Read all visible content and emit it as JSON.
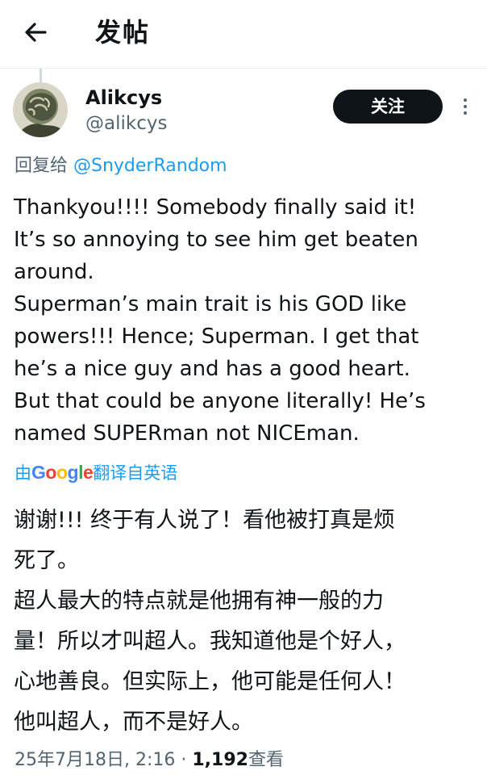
{
  "header": {
    "title": "发帖",
    "back_icon": "arrow-left-icon"
  },
  "author": {
    "display_name": "Alikcys",
    "handle": "@alikcys",
    "follow_label": "关注",
    "more_icon": "more-vertical-icon"
  },
  "reply": {
    "prefix": "回复给 ",
    "to": "@SnyderRandom"
  },
  "tweet": {
    "lines": [
      "Thankyou!!!! Somebody finally said it!",
      "It’s so annoying to see him get beaten",
      "around.",
      "Superman’s main trait is his GOD like",
      "powers!!! Hence; Superman. I get that",
      "he’s a nice guy and has a good heart.",
      "But that could be anyone literally! He’s",
      "named SUPERman not NICEman."
    ]
  },
  "translation": {
    "by": "由",
    "brand": "Google",
    "suffix": "翻译自英语",
    "lines": [
      "谢谢!!!  终于有人说了！看他被打真是烦",
      "死了。",
      "超人最大的特点就是他拥有神一般的力",
      "量！所以才叫超人。我知道他是个好人，",
      "心地善良。但实际上，他可能是任何人！",
      "他叫超人，而不是好人。"
    ]
  },
  "meta": {
    "datetime": "25年7月18日, 2:16",
    "separator": " · ",
    "views_count": "1,192",
    "views_label": "查看"
  },
  "colors": {
    "link": "#1d9bf0",
    "text": "#0f1419",
    "secondary": "#536471",
    "google_blue": "#4285f4",
    "google_red": "#ea4335",
    "google_yellow": "#fbbc05",
    "google_green": "#34a853"
  }
}
